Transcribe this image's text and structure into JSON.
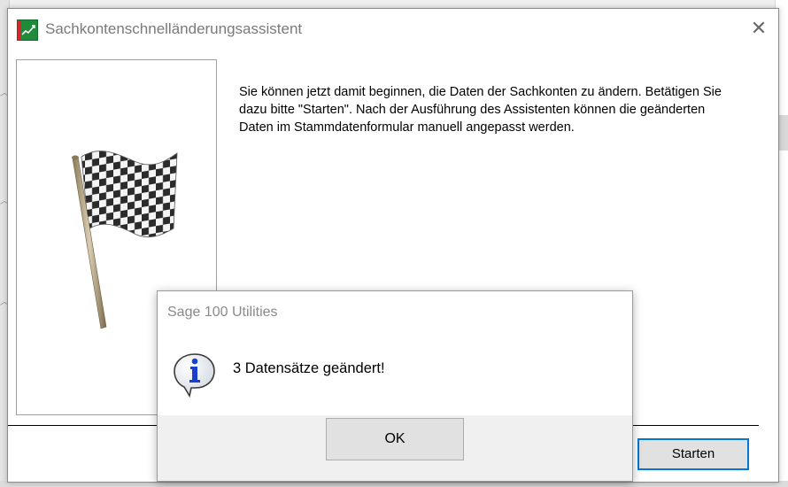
{
  "wizard": {
    "title": "Sachkontenschnelländerungsassistent",
    "close_label": "✕",
    "info_text": "Sie können jetzt damit beginnen, die Daten der Sachkonten zu ändern. Betätigen Sie dazu bitte \"Starten\". Nach der Ausführung des Assistenten können die geänderten Daten im Stammdatenformular manuell angepasst werden.",
    "start_label": "Starten"
  },
  "messagebox": {
    "title": "Sage 100 Utilities",
    "message": "3 Datensätze geändert!",
    "ok_label": "OK"
  },
  "icons": {
    "app": "sage-chart-icon",
    "flag": "checkered-flag-icon",
    "info": "info-speech-bubble-icon"
  },
  "colors": {
    "accent": "#0078d7",
    "info_blue": "#1a3fcf"
  }
}
